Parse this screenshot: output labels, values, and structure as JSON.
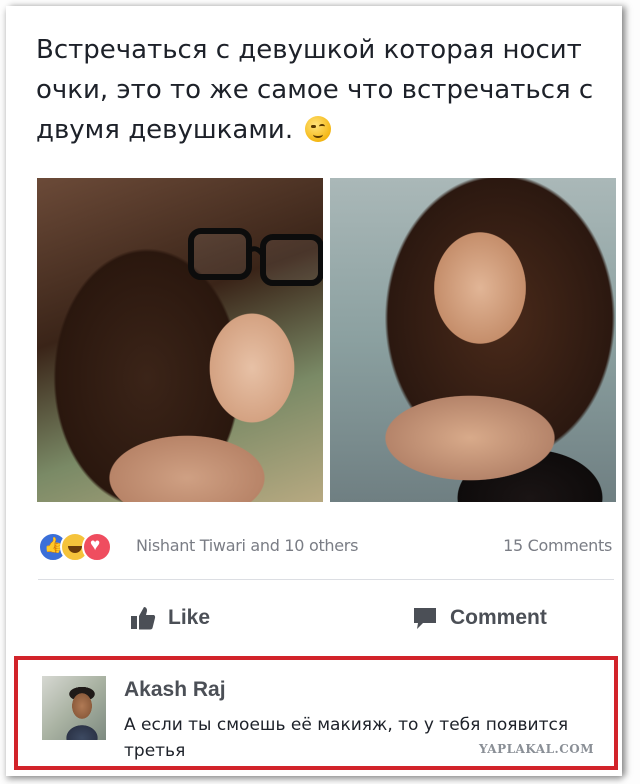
{
  "post": {
    "text_lines": [
      "Встречаться с девушкой которая носит",
      "очки, это то же самое что встречаться с",
      "двумя девушками."
    ],
    "emoji": "wink-emoji"
  },
  "photos": {
    "left": "girl-with-glasses-photo",
    "right": "girl-without-glasses-photo"
  },
  "reactions": {
    "icons": [
      "like-icon",
      "haha-icon",
      "love-icon"
    ],
    "summary": "Nishant Tiwari and 10 others",
    "comments_count": "15 Comments"
  },
  "actions": {
    "like_label": "Like",
    "comment_label": "Comment"
  },
  "comment": {
    "author": "Akash Raj",
    "text": "А если ты смоешь её макияж, то у тебя появится третья"
  },
  "watermark": "YAPLAKAL.COM",
  "colors": {
    "highlight_border": "#d2232a",
    "like_blue": "#3b6fd8",
    "love_red": "#ef4d5f",
    "haha_yellow": "#f5c33b",
    "text_dark": "#1d2129",
    "text_gray": "#7a7d85"
  }
}
